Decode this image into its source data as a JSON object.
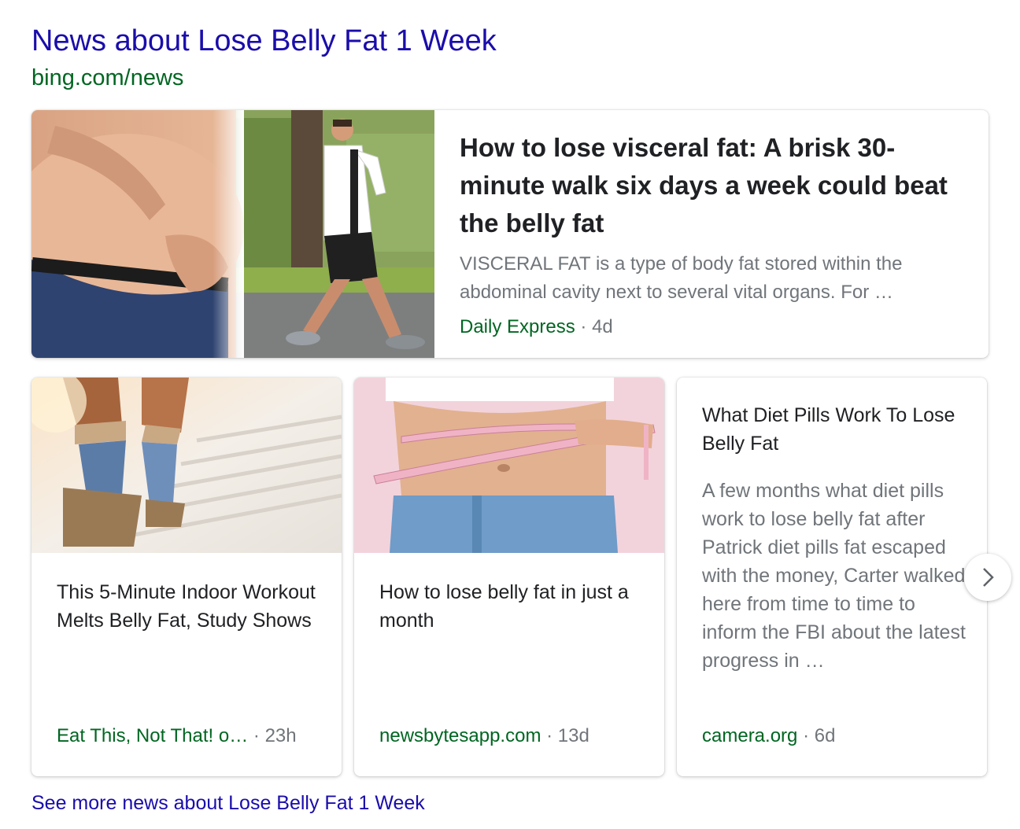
{
  "section": {
    "title": "News about Lose Belly Fat 1 Week",
    "url": "bing.com/news"
  },
  "featured": {
    "headline": "How to lose visceral fat: A brisk 30-minute walk six days a week could beat the belly fat",
    "snippet": "VISCERAL FAT is a type of body fat stored within the abdominal cavity next to several vital organs. For …",
    "source": "Daily Express",
    "separator": "·",
    "age": "4d"
  },
  "cards": [
    {
      "headline": "This 5-Minute Indoor Workout Melts Belly Fat, Study Shows",
      "source": "Eat This, Not That! o…",
      "separator": "·",
      "age": "23h"
    },
    {
      "headline": "How to lose belly fat in just a month",
      "source": "newsbytesapp.com",
      "separator": "·",
      "age": "13d"
    },
    {
      "headline": "What Diet Pills Work To Lose Belly Fat",
      "snippet": "A few months what diet pills work to lose belly fat after Patrick diet pills fat escaped with the money, Carter walked here from time to time to inform the FBI about the latest progress in …",
      "source": "camera.org",
      "separator": "·",
      "age": "6d"
    }
  ],
  "carousel": {
    "next_icon": "chevron-right-icon"
  },
  "footer": {
    "more_link": "See more news about Lose Belly Fat 1 Week"
  },
  "colors": {
    "link": "#1a0dab",
    "url_green": "#006621",
    "headline": "#202124",
    "snippet_gray": "#70757a"
  }
}
